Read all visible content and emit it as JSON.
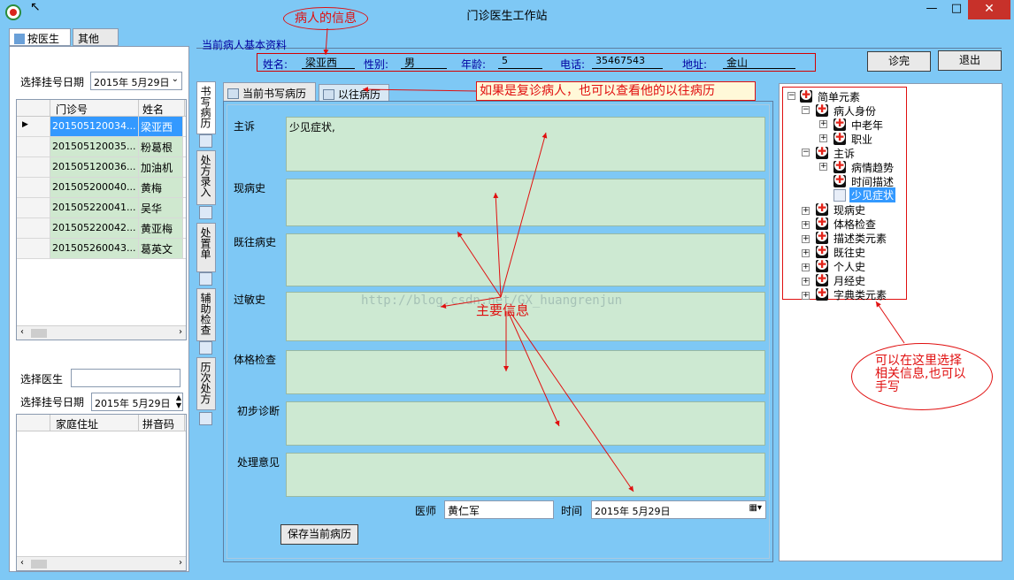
{
  "window": {
    "title": "门诊医生工作站",
    "minimize": "—",
    "maximize": "□",
    "close": "✕"
  },
  "left": {
    "tabs": [
      "按医生",
      "其他"
    ],
    "date_label": "选择挂号日期",
    "date_value": "2015年 5月29日",
    "grid1": {
      "headers": [
        "门诊号",
        "姓名"
      ],
      "rows": [
        [
          "201505120034...",
          "梁亚西"
        ],
        [
          "201505120035...",
          "粉葛根"
        ],
        [
          "201505120036...",
          "加油机"
        ],
        [
          "201505200040...",
          "黄梅"
        ],
        [
          "201505220041...",
          "吴华"
        ],
        [
          "201505220042...",
          "黄亚梅"
        ],
        [
          "201505260043...",
          "葛英文"
        ]
      ]
    },
    "doctor_label": "选择医生",
    "doctor_value": "",
    "date2_label": "选择挂号日期",
    "date2_value": "2015年 5月29日",
    "grid2": {
      "headers": [
        "家庭住址",
        "拼音码"
      ]
    }
  },
  "vtabs": [
    "书写病历",
    "处方录入",
    "处置单",
    "辅助检查",
    "历次处方"
  ],
  "info": {
    "section_title": "当前病人基本资料",
    "name_label": "姓名:",
    "name_value": "梁亚西",
    "gender_label": "性别:",
    "gender_value": "男",
    "age_label": "年龄:",
    "age_value": "5",
    "phone_label": "电话:",
    "phone_value": "35467543",
    "address_label": "地址:",
    "address_value": "金山",
    "finish_button": "诊完",
    "exit_button": "退出"
  },
  "record": {
    "tab_current": "当前书写病历",
    "tab_history": "以往病历",
    "fields": [
      {
        "label": "主诉",
        "value": "少见症状,"
      },
      {
        "label": "现病史",
        "value": ""
      },
      {
        "label": "既往病史",
        "value": ""
      },
      {
        "label": "过敏史",
        "value": ""
      },
      {
        "label": "体格检查",
        "value": ""
      },
      {
        "label": "初步诊断",
        "value": ""
      },
      {
        "label": "处理意见",
        "value": ""
      }
    ],
    "doctor_label": "医师",
    "doctor_value": "黄仁军",
    "time_label": "时间",
    "time_value": "2015年 5月29日",
    "save_button": "保存当前病历"
  },
  "tree": {
    "root": "简单元素",
    "nodes": [
      "病人身份",
      "中老年",
      "职业",
      "主诉",
      "病情趋势",
      "时间描述",
      "少见症状",
      "现病史",
      "体格检查",
      "描述类元素",
      "既往史",
      "个人史",
      "月经史",
      "字典类元素"
    ]
  },
  "annotations": {
    "patient_info": "病人的信息",
    "history_note": "如果是复诊病人，也可以查看他的以往病历",
    "main_info": "主要信息",
    "tree_note": "可以在这里选择相关信息,也可以手写",
    "watermark": "http://blog.csdn.net/GX_huangrenjun"
  },
  "colors": {
    "window_bg": "#7ec8f5",
    "field_bg": "#cde9d2",
    "selected_row": "#3399ff",
    "annotation": "#e01010"
  }
}
